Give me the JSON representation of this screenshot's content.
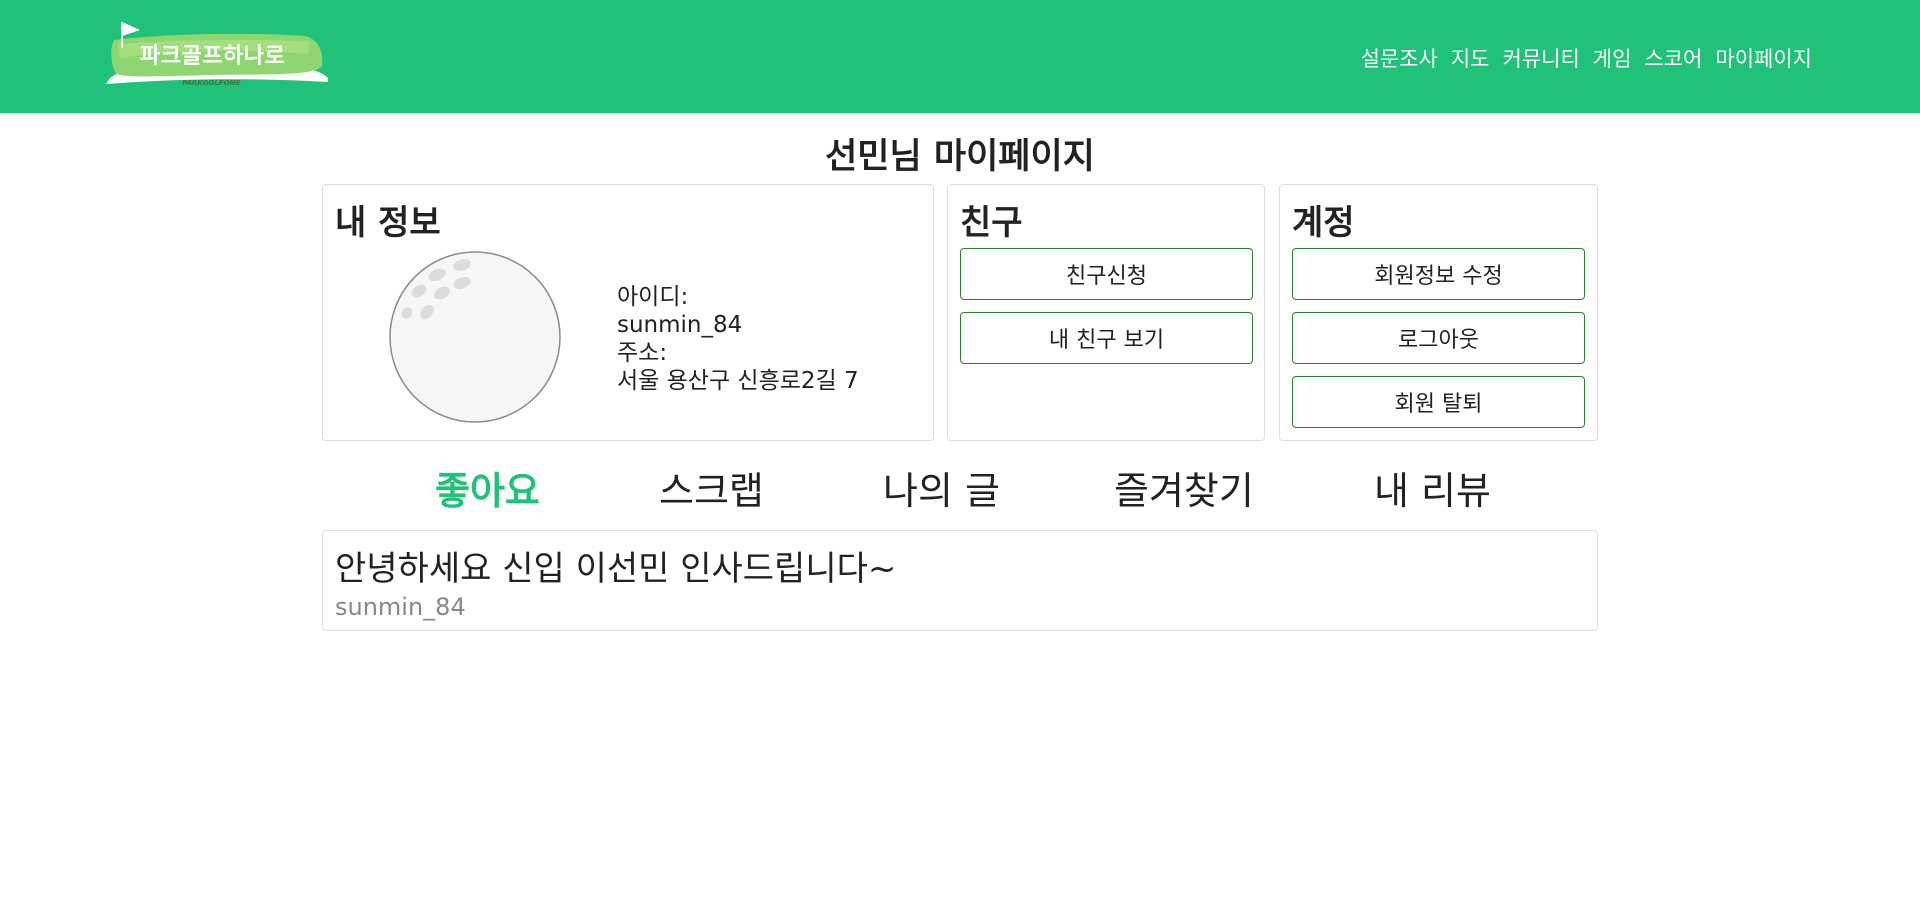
{
  "header": {
    "logo_text": "파크골프하나로",
    "logo_subtext": "PARKGOLFONE",
    "nav": [
      "설문조사",
      "지도",
      "커뮤니티",
      "게임",
      "스코어",
      "마이페이지"
    ],
    "bg_color": "#20c27a"
  },
  "page_title": "선민님 마이페이지",
  "info_card": {
    "title": "내 정보",
    "avatar_icon": "golf-ball-icon",
    "id_label": "아이디:",
    "id_value": "sunmin_84",
    "address_label": "주소:",
    "address_value": "서울 용산구 신흥로2길 7"
  },
  "friend_card": {
    "title": "친구",
    "buttons": [
      "친구신청",
      "내 친구 보기"
    ]
  },
  "account_card": {
    "title": "계정",
    "buttons": [
      "회원정보 수정",
      "로그아웃",
      "회원 탈퇴"
    ]
  },
  "tabs": [
    "좋아요",
    "스크랩",
    "나의 글",
    "즐겨찾기",
    "내 리뷰"
  ],
  "active_tab": "좋아요",
  "posts": [
    {
      "title": "안녕하세요 신입 이선민 인사드립니다~",
      "author": "sunmin_84"
    }
  ]
}
